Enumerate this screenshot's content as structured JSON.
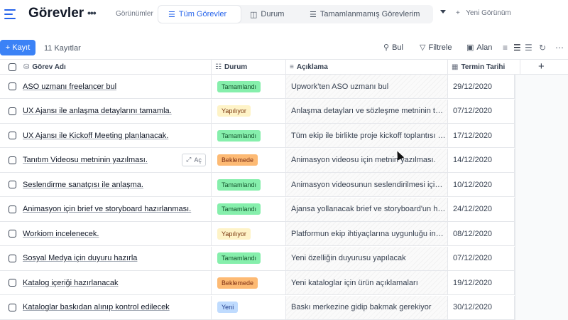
{
  "header": {
    "title": "Görevler",
    "views_label": "Görünümler",
    "tabs": [
      {
        "label": "Tüm Görevler",
        "icon": "list-icon",
        "active": true
      },
      {
        "label": "Durum",
        "icon": "board-icon",
        "active": false
      },
      {
        "label": "Tamamlanmamış Görevlerim",
        "icon": "list-icon",
        "active": false
      }
    ],
    "new_view": "Yeni Görünüm"
  },
  "toolbar": {
    "record_button": "Kayıt",
    "record_count": "11 Kayıtlar",
    "search": "Bul",
    "filter": "Filtrele",
    "fields": "Alan"
  },
  "columns": {
    "name": "Görev Adı",
    "status": "Durum",
    "description": "Açıklama",
    "due_date": "Termin Tarihi"
  },
  "open_label": "Aç",
  "status_colors": {
    "Tamamlandı": {
      "bg": "#86efac",
      "fg": "#14532d"
    },
    "Yapılıyor": {
      "bg": "#fef3c7",
      "fg": "#78350f"
    },
    "Beklemede": {
      "bg": "#fdba74",
      "fg": "#7c2d12"
    },
    "Yeni": {
      "bg": "#bfdbfe",
      "fg": "#1e3a8a"
    }
  },
  "rows": [
    {
      "name": "ASO uzmanı freelancer bul",
      "status": "Tamamlandı",
      "description": "Upwork'ten ASO uzmanı bul",
      "date": "29/12/2020"
    },
    {
      "name": "UX Ajansı ile anlaşma detaylarını tamamla.",
      "status": "Yapılıyor",
      "description": "Anlaşma detayları ve sözleşme metninin tamamlanması",
      "date": "07/12/2020"
    },
    {
      "name": "UX Ajansı ile Kickoff Meeting planlanacak.",
      "status": "Tamamlandı",
      "description": "Tüm ekip ile birlikte proje kickoff toplantısı planlanacak",
      "date": "17/12/2020"
    },
    {
      "name": "Tanıtım Videosu metninin yazılması.",
      "status": "Beklemede",
      "description": "Animasyon videosu için metnin yazılması.",
      "date": "14/12/2020"
    },
    {
      "name": "Seslendirme sanatçısı ile anlaşma.",
      "status": "Tamamlandı",
      "description": "Animasyon videosunun seslendirilmesi için sanatçı",
      "date": "10/12/2020"
    },
    {
      "name": "Animasyon için brief ve storyboard hazırlanması.",
      "status": "Tamamlandı",
      "description": "Ajansa yollanacak brief ve storyboard'un hazırlanması",
      "date": "24/12/2020"
    },
    {
      "name": "Workiom incelenecek.",
      "status": "Yapılıyor",
      "description": "Platformun ekip ihtiyaçlarına uygunluğu incelenecek",
      "date": "08/12/2020"
    },
    {
      "name": "Sosyal Medya için duyuru hazırla",
      "status": "Tamamlandı",
      "description": "Yeni özelliğin duyurusu yapılacak",
      "date": "07/12/2020"
    },
    {
      "name": "Katalog içeriği hazırlanacak",
      "status": "Beklemede",
      "description": "Yeni kataloglar için ürün açıklamaları",
      "date": "19/12/2020"
    },
    {
      "name": "Kataloglar baskıdan alınıp kontrol edilecek",
      "status": "Yeni",
      "description": "Baskı merkezine gidip bakmak gerekiyor",
      "date": "30/12/2020"
    }
  ]
}
